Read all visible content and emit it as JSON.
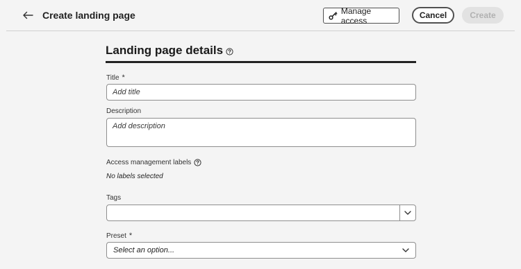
{
  "header": {
    "title": "Create landing page",
    "manage_access_label": "Manage access",
    "cancel_label": "Cancel",
    "create_label": "Create"
  },
  "section": {
    "title": "Landing page details"
  },
  "form": {
    "title": {
      "label": "Title",
      "required": "*",
      "placeholder": "Add title",
      "value": ""
    },
    "description": {
      "label": "Description",
      "placeholder": "Add description",
      "value": ""
    },
    "access_labels": {
      "label": "Access management labels",
      "value": "No labels selected"
    },
    "tags": {
      "label": "Tags",
      "value": ""
    },
    "preset": {
      "label": "Preset",
      "required": "*",
      "selected": "Select an option..."
    }
  },
  "colors": {
    "primary_text": "#222222",
    "disabled_bg": "#e2e2e2",
    "disabled_text": "#b1b1b1",
    "background": "#f4f4f4"
  }
}
